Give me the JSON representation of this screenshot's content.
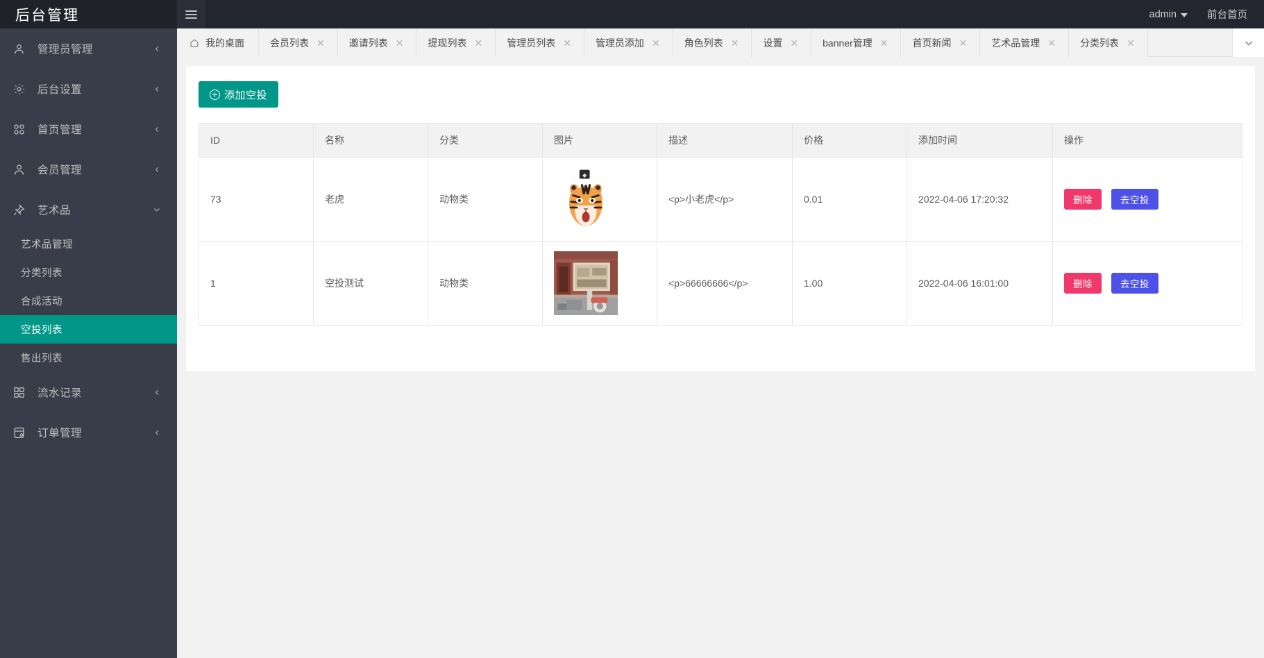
{
  "header": {
    "logo_text": "后台管理",
    "menu_toggle_icon": "hamburger-icon",
    "user_name": "admin",
    "user_caret_icon": "chevron-down-icon",
    "front_page_link": "前台首页"
  },
  "sidebar": {
    "items": [
      {
        "label": "管理员管理",
        "icon": "user-icon",
        "expanded": false,
        "arrow": "chevron-left-icon"
      },
      {
        "label": "后台设置",
        "icon": "gear-icon",
        "expanded": false,
        "arrow": "chevron-left-icon"
      },
      {
        "label": "首页管理",
        "icon": "apps-icon",
        "expanded": false,
        "arrow": "chevron-left-icon"
      },
      {
        "label": "会员管理",
        "icon": "person-icon",
        "expanded": false,
        "arrow": "chevron-left-icon"
      },
      {
        "label": "艺术品",
        "icon": "pin-icon",
        "expanded": true,
        "arrow": "chevron-down-icon"
      }
    ],
    "artwork_children": [
      {
        "label": "艺术品管理",
        "active": false
      },
      {
        "label": "分类列表",
        "active": false
      },
      {
        "label": "合成活动",
        "active": false
      },
      {
        "label": "空投列表",
        "active": true
      },
      {
        "label": "售出列表",
        "active": false
      }
    ],
    "items_bottom": [
      {
        "label": "流水记录",
        "icon": "grid-icon",
        "expanded": false,
        "arrow": "chevron-left-icon"
      },
      {
        "label": "订单管理",
        "icon": "order-icon",
        "expanded": false,
        "arrow": "chevron-left-icon"
      }
    ],
    "active_color": "#009688",
    "background_color": "#393d49"
  },
  "tabbar": {
    "home_tab": {
      "label": "我的桌面",
      "icon": "home-icon",
      "closable": false
    },
    "tabs": [
      {
        "label": "会员列表",
        "closable": true
      },
      {
        "label": "邀请列表",
        "closable": true
      },
      {
        "label": "提现列表",
        "closable": true
      },
      {
        "label": "管理员列表",
        "closable": true
      },
      {
        "label": "管理员添加",
        "closable": true
      },
      {
        "label": "角色列表",
        "closable": true
      },
      {
        "label": "设置",
        "closable": true
      },
      {
        "label": "banner管理",
        "closable": true
      },
      {
        "label": "首页新闻",
        "closable": true
      },
      {
        "label": "艺术品管理",
        "closable": true
      },
      {
        "label": "分类列表",
        "closable": true
      }
    ],
    "close_icon": "close-icon",
    "dropdown_icon": "chevron-down-icon"
  },
  "toolbar": {
    "add_label": "添加空投",
    "add_icon": "plus-circle-icon",
    "add_color": "#009688"
  },
  "table": {
    "columns": [
      "ID",
      "名称",
      "分类",
      "图片",
      "描述",
      "价格",
      "添加时间",
      "操作"
    ],
    "rows": [
      {
        "id": "73",
        "name": "老虎",
        "category": "动物类",
        "image_alt": "tiger-thumbnail",
        "description": "<p>小老虎</p>",
        "price": "0.01",
        "created_at": "2022-04-06 17:20:32",
        "actions": [
          {
            "label": "删除",
            "color": "#f0386b"
          },
          {
            "label": "去空投",
            "color": "#4e51e8"
          }
        ]
      },
      {
        "id": "1",
        "name": "空投测试",
        "category": "动物类",
        "image_alt": "storefront-thumbnail",
        "description": "<p>66666666</p>",
        "price": "1.00",
        "created_at": "2022-04-06 16:01:00",
        "actions": [
          {
            "label": "删除",
            "color": "#f0386b"
          },
          {
            "label": "去空投",
            "color": "#4e51e8"
          }
        ]
      }
    ]
  }
}
